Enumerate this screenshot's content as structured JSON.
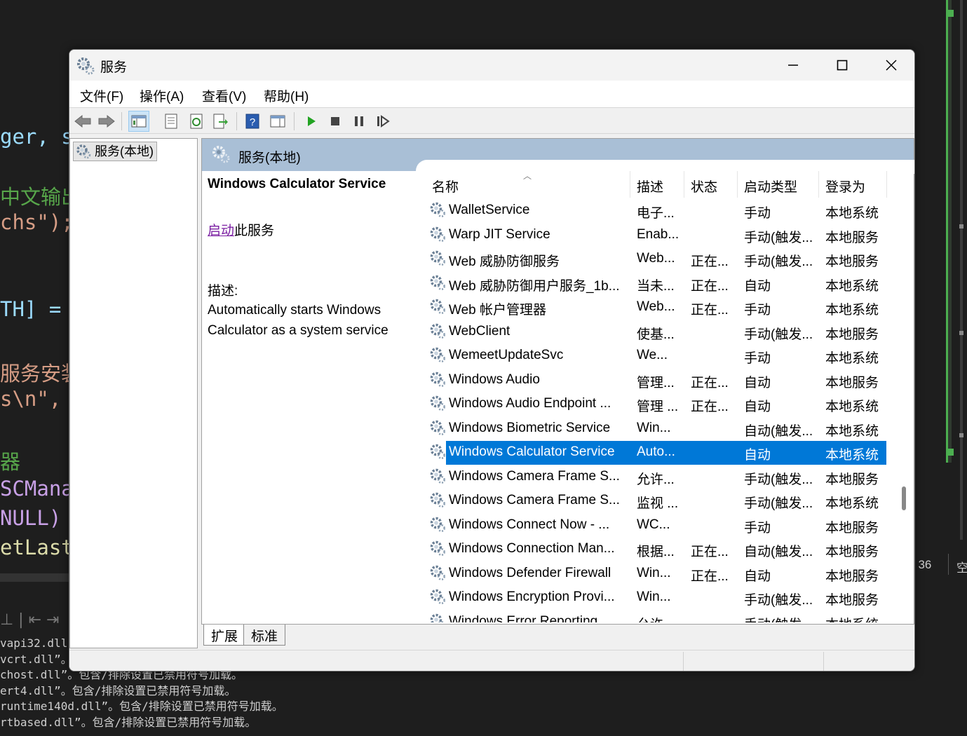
{
  "ide": {
    "code_lines": [
      {
        "text": "ger, s",
        "color": "#9cdcfe"
      },
      {
        "text": "中文输出",
        "color": "#57a64a"
      },
      {
        "text": "chs\");",
        "color": "#d69d85"
      },
      {
        "text": "TH] = ",
        "color": "#9cdcfe"
      },
      {
        "text": "服务安装",
        "color": "#d69d85"
      },
      {
        "text": "s\\n\",",
        "color": "#d69d85"
      },
      {
        "text": "器",
        "color": "#57a64a"
      },
      {
        "text": "SCMana",
        "color": "#c8a0e6"
      },
      {
        "text": " NULL)",
        "color": "#c8a0e6"
      },
      {
        "text": "etLast",
        "color": "#dcdcaa"
      }
    ],
    "output_lines": [
      "vapi32.dll”。包含/排除设置已禁用符号加载。",
      "vcrt.dll”。包含/排除设置已禁用符号加载。",
      "chost.dll”。包含/排除设置已禁用符号加载。",
      "ert4.dll”。包含/排除设置已禁用符号加载。",
      "runtime140d.dll”。包含/排除设置已禁用符号加载。",
      "rtbased.dll”。包含/排除设置已禁用符号加载。"
    ],
    "status_col": ": 36",
    "status_extra": "空"
  },
  "window": {
    "title": "服务",
    "icons": {
      "app": "gear-icon",
      "minimize": "minimize-icon",
      "maximize": "maximize-icon",
      "close": "close-icon"
    }
  },
  "menu": [
    "文件(F)",
    "操作(A)",
    "查看(V)",
    "帮助(H)"
  ],
  "tree": {
    "root_label": "服务(本地)"
  },
  "pane": {
    "header": "服务(本地)",
    "selected_service_name": "Windows Calculator Service",
    "start_link": "启动",
    "start_suffix": "此服务",
    "description_label": "描述:",
    "description_text": "Automatically starts Windows Calculator as a system service"
  },
  "columns": [
    "名称",
    "描述",
    "状态",
    "启动类型",
    "登录为"
  ],
  "services": [
    {
      "name": "WalletService",
      "desc": "电子...",
      "status": "",
      "startup": "手动",
      "logon": "本地系统"
    },
    {
      "name": "Warp JIT Service",
      "desc": "Enab...",
      "status": "",
      "startup": "手动(触发...",
      "logon": "本地服务"
    },
    {
      "name": "Web 威胁防御服务",
      "desc": "Web...",
      "status": "正在...",
      "startup": "手动(触发...",
      "logon": "本地服务"
    },
    {
      "name": "Web 威胁防御用户服务_1b...",
      "desc": "当未...",
      "status": "正在...",
      "startup": "自动",
      "logon": "本地系统"
    },
    {
      "name": "Web 帐户管理器",
      "desc": "Web...",
      "status": "正在...",
      "startup": "手动",
      "logon": "本地系统"
    },
    {
      "name": "WebClient",
      "desc": "使基...",
      "status": "",
      "startup": "手动(触发...",
      "logon": "本地服务"
    },
    {
      "name": "WemeetUpdateSvc",
      "desc": "We...",
      "status": "",
      "startup": "手动",
      "logon": "本地系统"
    },
    {
      "name": "Windows Audio",
      "desc": "管理...",
      "status": "正在...",
      "startup": "自动",
      "logon": "本地服务"
    },
    {
      "name": "Windows Audio Endpoint ...",
      "desc": "管理 ...",
      "status": "正在...",
      "startup": "自动",
      "logon": "本地系统"
    },
    {
      "name": "Windows Biometric Service",
      "desc": "Win...",
      "status": "",
      "startup": "自动(触发...",
      "logon": "本地系统"
    },
    {
      "name": "Windows Calculator Service",
      "desc": "Auto...",
      "status": "",
      "startup": "自动",
      "logon": "本地系统",
      "selected": true
    },
    {
      "name": "Windows Camera Frame S...",
      "desc": "允许...",
      "status": "",
      "startup": "手动(触发...",
      "logon": "本地服务"
    },
    {
      "name": "Windows Camera Frame S...",
      "desc": "监视 ...",
      "status": "",
      "startup": "手动(触发...",
      "logon": "本地系统"
    },
    {
      "name": "Windows Connect Now - ...",
      "desc": "WC...",
      "status": "",
      "startup": "手动",
      "logon": "本地服务"
    },
    {
      "name": "Windows Connection Man...",
      "desc": "根据...",
      "status": "正在...",
      "startup": "自动(触发...",
      "logon": "本地服务"
    },
    {
      "name": "Windows Defender Firewall",
      "desc": "Win...",
      "status": "正在...",
      "startup": "自动",
      "logon": "本地服务"
    },
    {
      "name": "Windows Encryption Provi...",
      "desc": "Win...",
      "status": "",
      "startup": "手动(触发...",
      "logon": "本地服务"
    },
    {
      "name": "Windows Error Reporting ...",
      "desc": "允许...",
      "status": "",
      "startup": "手动(触发...",
      "logon": "本地系统"
    }
  ],
  "tabs": [
    "扩展",
    "标准"
  ],
  "colors": {
    "selection": "#0078d7",
    "pane_header": "#a9bfd6",
    "link": "#7b1fa2"
  }
}
